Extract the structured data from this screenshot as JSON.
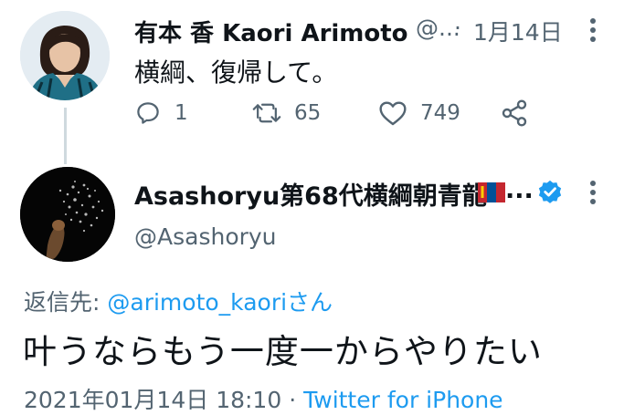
{
  "tweet1": {
    "display_name": "有本 香 Kaori Arimoto",
    "handle": "@...",
    "separator": "·",
    "date": "1月14日",
    "text": "横綱、復帰して。",
    "actions": {
      "reply_count": "1",
      "retweet_count": "65",
      "like_count": "749"
    }
  },
  "tweet2": {
    "display_name": "Asashoryu第68代横綱朝青龍",
    "name_ellipsis": "...",
    "handle": "@Asashoryu",
    "reply_prefix": "返信先:",
    "reply_to": "@arimoto_kaoriさん",
    "text": "叶うならもう一度一からやりたい",
    "timestamp": "2021年01月14日 18:10",
    "separator": "·",
    "source": "Twitter for iPhone"
  },
  "colors": {
    "accent": "#1d9bf0",
    "secondary_text": "#536471",
    "primary_text": "#0f1419"
  },
  "icons": [
    "reply-icon",
    "retweet-icon",
    "like-icon",
    "share-icon",
    "verified-badge-icon",
    "more-menu-icon",
    "mongolia-flag-icon"
  ]
}
